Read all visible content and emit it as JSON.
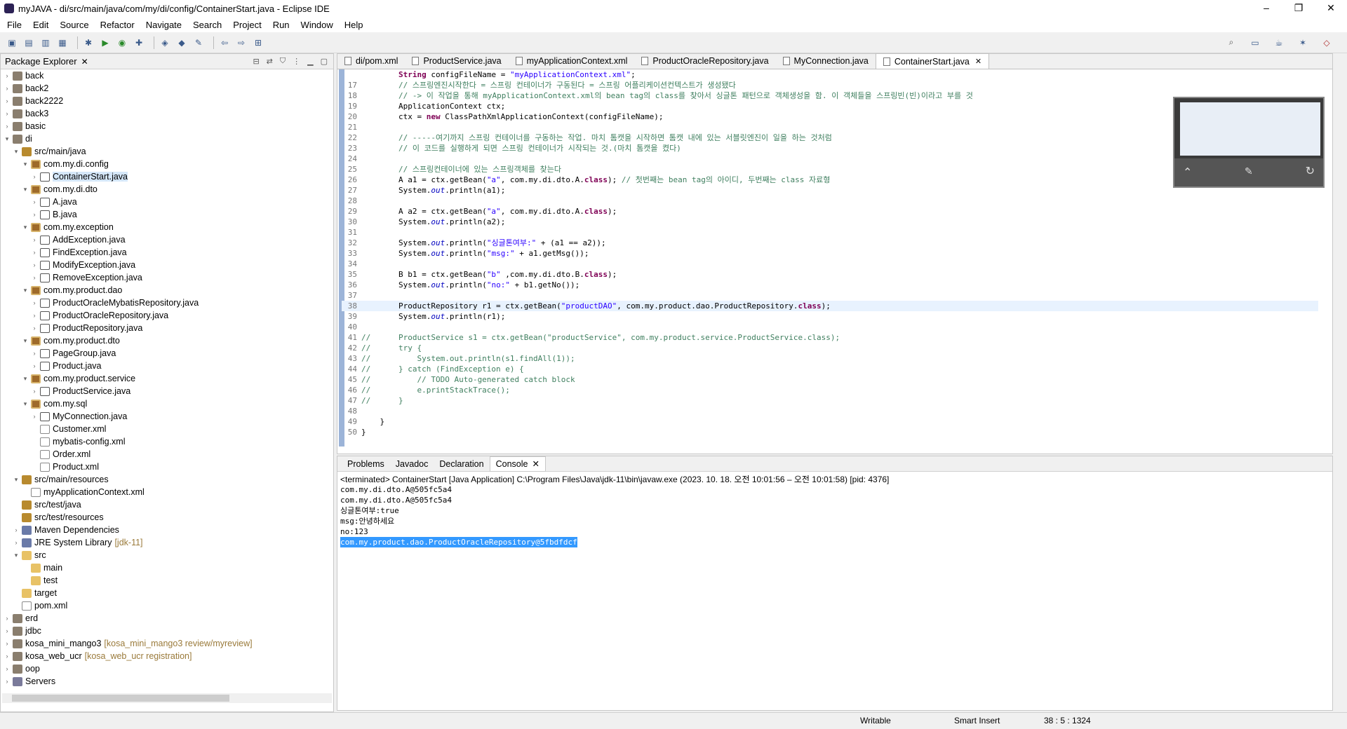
{
  "window": {
    "title": "myJAVA - di/src/main/java/com/my/di/config/ContainerStart.java - Eclipse IDE",
    "min": "–",
    "max": "❐",
    "close": "✕"
  },
  "menu": [
    "File",
    "Edit",
    "Source",
    "Refactor",
    "Navigate",
    "Search",
    "Project",
    "Run",
    "Window",
    "Help"
  ],
  "package_explorer": {
    "title": "Package Explorer",
    "items": [
      {
        "label": "back",
        "icon": "project-icon",
        "indent": 0,
        "arrow": ">"
      },
      {
        "label": "back2",
        "icon": "project-icon",
        "indent": 0,
        "arrow": ">"
      },
      {
        "label": "back2222",
        "icon": "project-icon",
        "indent": 0,
        "arrow": ">"
      },
      {
        "label": "back3",
        "icon": "project-icon",
        "indent": 0,
        "arrow": ">"
      },
      {
        "label": "basic",
        "icon": "project-icon",
        "indent": 0,
        "arrow": ">"
      },
      {
        "label": "di",
        "icon": "project-icon",
        "indent": 0,
        "arrow": "v"
      },
      {
        "label": "src/main/java",
        "icon": "source-folder-icon",
        "indent": 1,
        "arrow": "v"
      },
      {
        "label": "com.my.di.config",
        "icon": "package-icon",
        "indent": 2,
        "arrow": "v"
      },
      {
        "label": "ContainerStart.java",
        "icon": "java-file-icon",
        "indent": 3,
        "arrow": ">",
        "selected": true
      },
      {
        "label": "com.my.di.dto",
        "icon": "package-icon",
        "indent": 2,
        "arrow": "v"
      },
      {
        "label": "A.java",
        "icon": "java-file-icon",
        "indent": 3,
        "arrow": ">"
      },
      {
        "label": "B.java",
        "icon": "java-file-icon",
        "indent": 3,
        "arrow": ">"
      },
      {
        "label": "com.my.exception",
        "icon": "package-icon",
        "indent": 2,
        "arrow": "v"
      },
      {
        "label": "AddException.java",
        "icon": "java-file-icon",
        "indent": 3,
        "arrow": ">"
      },
      {
        "label": "FindException.java",
        "icon": "java-file-icon",
        "indent": 3,
        "arrow": ">"
      },
      {
        "label": "ModifyException.java",
        "icon": "java-file-icon",
        "indent": 3,
        "arrow": ">"
      },
      {
        "label": "RemoveException.java",
        "icon": "java-file-icon",
        "indent": 3,
        "arrow": ">"
      },
      {
        "label": "com.my.product.dao",
        "icon": "package-icon",
        "indent": 2,
        "arrow": "v"
      },
      {
        "label": "ProductOracleMybatisRepository.java",
        "icon": "java-file-icon",
        "indent": 3,
        "arrow": ">"
      },
      {
        "label": "ProductOracleRepository.java",
        "icon": "java-file-icon",
        "indent": 3,
        "arrow": ">"
      },
      {
        "label": "ProductRepository.java",
        "icon": "java-file-icon",
        "indent": 3,
        "arrow": ">"
      },
      {
        "label": "com.my.product.dto",
        "icon": "package-icon",
        "indent": 2,
        "arrow": "v"
      },
      {
        "label": "PageGroup.java",
        "icon": "java-file-icon",
        "indent": 3,
        "arrow": ">"
      },
      {
        "label": "Product.java",
        "icon": "java-file-icon",
        "indent": 3,
        "arrow": ">"
      },
      {
        "label": "com.my.product.service",
        "icon": "package-icon",
        "indent": 2,
        "arrow": "v"
      },
      {
        "label": "ProductService.java",
        "icon": "java-file-icon",
        "indent": 3,
        "arrow": ">"
      },
      {
        "label": "com.my.sql",
        "icon": "package-icon",
        "indent": 2,
        "arrow": "v"
      },
      {
        "label": "MyConnection.java",
        "icon": "java-file-icon",
        "indent": 3,
        "arrow": ">"
      },
      {
        "label": "Customer.xml",
        "icon": "xml-file-icon",
        "indent": 3,
        "arrow": ""
      },
      {
        "label": "mybatis-config.xml",
        "icon": "xml-file-icon",
        "indent": 3,
        "arrow": ""
      },
      {
        "label": "Order.xml",
        "icon": "xml-file-icon",
        "indent": 3,
        "arrow": ""
      },
      {
        "label": "Product.xml",
        "icon": "xml-file-icon",
        "indent": 3,
        "arrow": ""
      },
      {
        "label": "src/main/resources",
        "icon": "source-folder-icon",
        "indent": 1,
        "arrow": "v"
      },
      {
        "label": "myApplicationContext.xml",
        "icon": "xml-file-icon",
        "indent": 2,
        "arrow": ""
      },
      {
        "label": "src/test/java",
        "icon": "source-folder-icon",
        "indent": 1,
        "arrow": ""
      },
      {
        "label": "src/test/resources",
        "icon": "source-folder-icon",
        "indent": 1,
        "arrow": ""
      },
      {
        "label": "Maven Dependencies",
        "icon": "library-icon",
        "indent": 1,
        "arrow": ">"
      },
      {
        "label": "JRE System Library",
        "icon": "library-icon",
        "indent": 1,
        "arrow": ">",
        "decoration": "[jdk-11]"
      },
      {
        "label": "src",
        "icon": "folder-icon",
        "indent": 1,
        "arrow": "v"
      },
      {
        "label": "main",
        "icon": "folder-icon",
        "indent": 2,
        "arrow": ""
      },
      {
        "label": "test",
        "icon": "folder-icon",
        "indent": 2,
        "arrow": ""
      },
      {
        "label": "target",
        "icon": "folder-icon",
        "indent": 1,
        "arrow": ""
      },
      {
        "label": "pom.xml",
        "icon": "xml-file-icon",
        "indent": 1,
        "arrow": ""
      },
      {
        "label": "erd",
        "icon": "project-icon",
        "indent": 0,
        "arrow": ">"
      },
      {
        "label": "jdbc",
        "icon": "project-icon",
        "indent": 0,
        "arrow": ">"
      },
      {
        "label": "kosa_mini_mango3",
        "icon": "project-icon",
        "indent": 0,
        "arrow": ">",
        "decoration": "[kosa_mini_mango3 review/myreview]"
      },
      {
        "label": "kosa_web_ucr",
        "icon": "project-icon",
        "indent": 0,
        "arrow": ">",
        "decoration": "[kosa_web_ucr registration]"
      },
      {
        "label": "oop",
        "icon": "project-icon",
        "indent": 0,
        "arrow": ">"
      },
      {
        "label": "Servers",
        "icon": "server-icon",
        "indent": 0,
        "arrow": ">"
      }
    ]
  },
  "editor": {
    "tabs": [
      {
        "label": "di/pom.xml"
      },
      {
        "label": "ProductService.java"
      },
      {
        "label": "myApplicationContext.xml"
      },
      {
        "label": "ProductOracleRepository.java"
      },
      {
        "label": "MyConnection.java"
      },
      {
        "label": "ContainerStart.java",
        "active": true
      }
    ],
    "current_line": 38,
    "lines": [
      {
        "n": "",
        "html": "        <span class=\"kw\">String</span> configFileName = <span class=\"st\">\"myApplicationContext.xml\"</span>;"
      },
      {
        "n": "17",
        "html": "        <span class=\"cm\">// 스프링엔진시작한다 = 스프링 컨테이너가 구동된다 = 스프링 어플리케이션컨텍스트가 생성됐다</span>"
      },
      {
        "n": "18",
        "html": "        <span class=\"cm\">// -> 이 작업을 통해 myApplicationContext.xml의 bean tag의 class를 찾아서 싱글톤 패턴으로 객체생성을 함. 이 객체들을 스프링빈(빈)이라고 부를 것</span>"
      },
      {
        "n": "19",
        "html": "        ApplicationContext ctx;"
      },
      {
        "n": "20",
        "html": "        ctx = <span class=\"kw\">new</span> ClassPathXmlApplicationContext(configFileName);"
      },
      {
        "n": "21",
        "html": ""
      },
      {
        "n": "22",
        "html": "        <span class=\"cm\">// -----여기까지 스프링 컨테이너를 구동하는 작업. 마치 톰캣을 시작하면 톰캣 내에 있는 서블릿엔진이 일을 하는 것처럼</span>"
      },
      {
        "n": "23",
        "html": "        <span class=\"cm\">// 이 코드를 실행하게 되면 스프링 컨테이너가 시작되는 것.(마치 톰캣을 켰다)</span>"
      },
      {
        "n": "24",
        "html": ""
      },
      {
        "n": "25",
        "html": "        <span class=\"cm\">// 스프링컨테이너에 있는 스프링객체를 찾는다</span>"
      },
      {
        "n": "26",
        "html": "        A a1 = ctx.getBean(<span class=\"st\">\"a\"</span>, com.my.di.dto.A.<span class=\"kw\">class</span>); <span class=\"cm\">// 첫번째는 bean tag의 아이디, 두번째는 class 자료형</span>"
      },
      {
        "n": "27",
        "html": "        System.<span class=\"it\">out</span>.println(a1);"
      },
      {
        "n": "28",
        "html": ""
      },
      {
        "n": "29",
        "html": "        A a2 = ctx.getBean(<span class=\"st\">\"a\"</span>, com.my.di.dto.A.<span class=\"kw\">class</span>);"
      },
      {
        "n": "30",
        "html": "        System.<span class=\"it\">out</span>.println(a2);"
      },
      {
        "n": "31",
        "html": ""
      },
      {
        "n": "32",
        "html": "        System.<span class=\"it\">out</span>.println(<span class=\"st\">\"싱글톤여부:\"</span> + (a1 == a2));"
      },
      {
        "n": "33",
        "html": "        System.<span class=\"it\">out</span>.println(<span class=\"st\">\"msg:\"</span> + a1.getMsg());"
      },
      {
        "n": "34",
        "html": ""
      },
      {
        "n": "35",
        "html": "        B b1 = ctx.getBean(<span class=\"st\">\"b\"</span> ,com.my.di.dto.B.<span class=\"kw\">class</span>);"
      },
      {
        "n": "36",
        "html": "        System.<span class=\"it\">out</span>.println(<span class=\"st\">\"no:\"</span> + b1.getNo());"
      },
      {
        "n": "37",
        "html": ""
      },
      {
        "n": "38",
        "html": "        ProductRepository r1 = ctx.getBean(<span class=\"st\">\"productDAO\"</span>, com.my.product.dao.ProductRepository.<span class=\"kw\">class</span>);"
      },
      {
        "n": "39",
        "html": "        System.<span class=\"it\">out</span>.println(r1);"
      },
      {
        "n": "40",
        "html": ""
      },
      {
        "n": "41",
        "html": "<span class=\"cm\">//      ProductService s1 = ctx.getBean(\"productService\", com.my.product.service.ProductService.class);</span>"
      },
      {
        "n": "42",
        "html": "<span class=\"cm\">//      try {</span>"
      },
      {
        "n": "43",
        "html": "<span class=\"cm\">//          System.out.println(s1.findAll(1));</span>"
      },
      {
        "n": "44",
        "html": "<span class=\"cm\">//      } catch (FindException e) {</span>"
      },
      {
        "n": "45",
        "html": "<span class=\"cm\">//          // TODO Auto-generated catch block</span>"
      },
      {
        "n": "46",
        "html": "<span class=\"cm\">//          e.printStackTrace();</span>"
      },
      {
        "n": "47",
        "html": "<span class=\"cm\">//      }</span>"
      },
      {
        "n": "48",
        "html": ""
      },
      {
        "n": "49",
        "html": "    }"
      },
      {
        "n": "50",
        "html": "}"
      }
    ]
  },
  "console": {
    "tabs": [
      {
        "label": "Problems"
      },
      {
        "label": "Javadoc"
      },
      {
        "label": "Declaration"
      },
      {
        "label": "Console",
        "active": true
      }
    ],
    "header": "<terminated> ContainerStart [Java Application] C:\\Program Files\\Java\\jdk-11\\bin\\javaw.exe  (2023. 10. 18. 오전 10:01:56 – 오전 10:01:58) [pid: 4376]",
    "output": [
      "com.my.di.dto.A@505fc5a4",
      "com.my.di.dto.A@505fc5a4",
      "싱글톤여부:true",
      "msg:안녕하세요",
      "no:123",
      "com.my.product.dao.ProductOracleRepository@5fbdfdcf"
    ],
    "highlight_line": 5
  },
  "statusbar": {
    "mode": "Writable",
    "insert": "Smart Insert",
    "position": "38 : 5 : 1324"
  }
}
